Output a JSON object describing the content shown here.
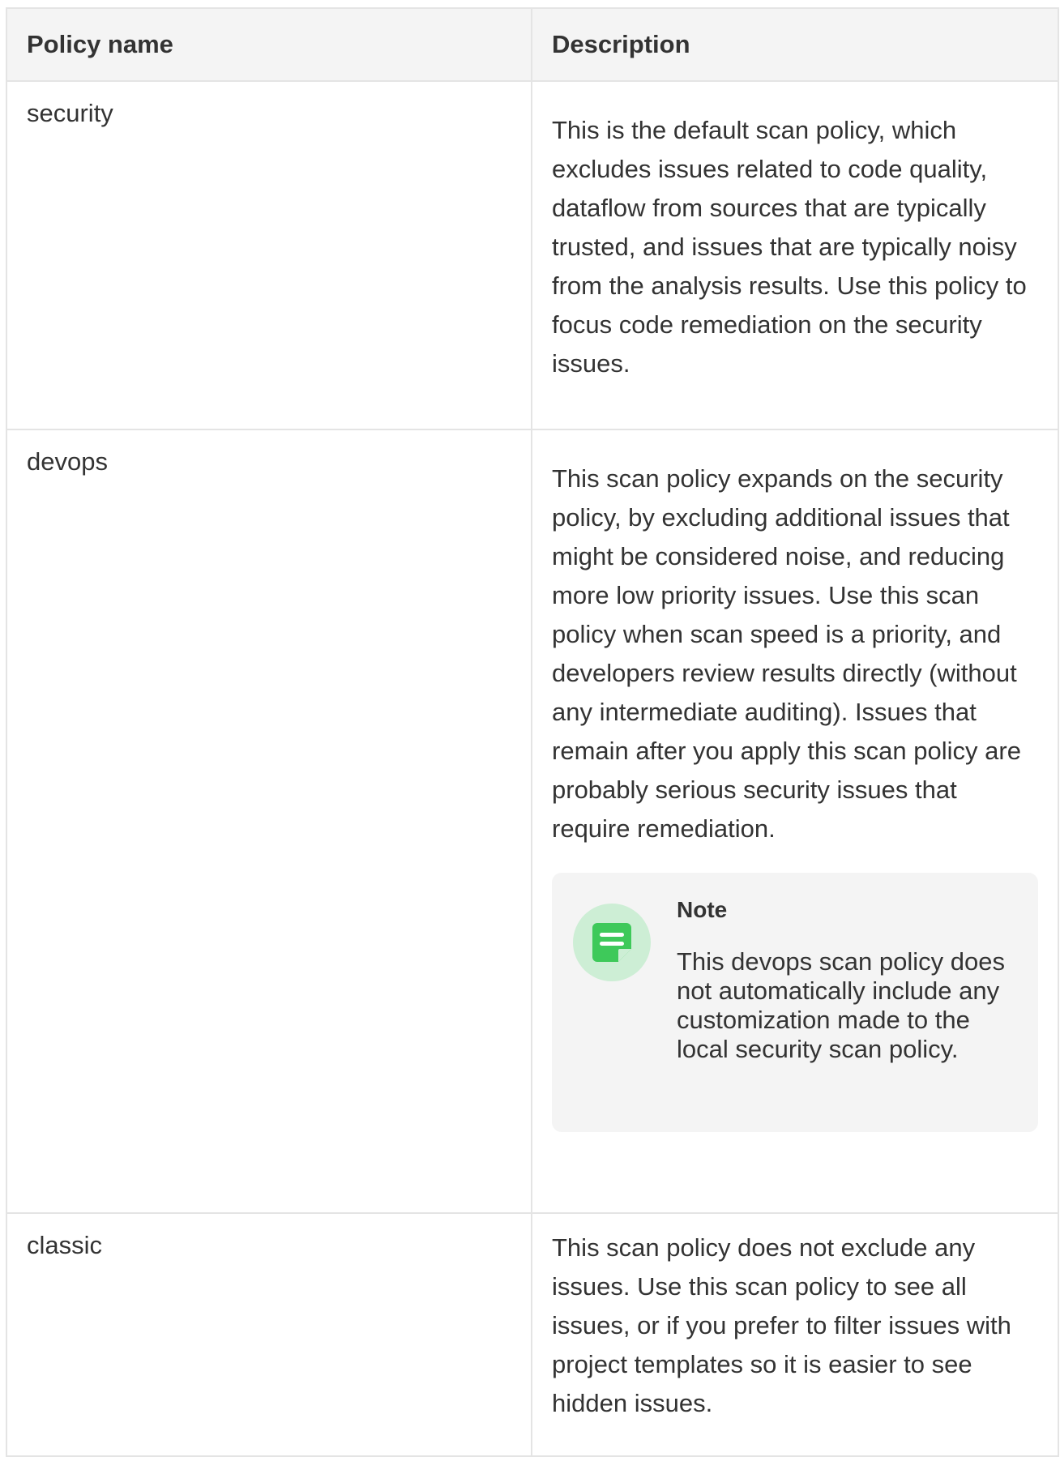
{
  "table": {
    "headers": {
      "policy_name": "Policy name",
      "description": "Description"
    },
    "rows": [
      {
        "name": "security",
        "description": "This is the default scan policy, which excludes issues related to code quality, dataflow from sources that are typically trusted, and issues that are typically noisy from the analysis results. Use this policy to focus code remediation on the security issues."
      },
      {
        "name": "devops",
        "description": "This scan policy expands on the security policy, by excluding additional issues that might be considered noise, and reducing more low priority issues. Use this scan policy when scan speed is a priority, and developers review results directly (without any intermediate auditing). Issues that remain after you apply this scan policy are probably serious security issues that require remediation.",
        "note": {
          "title": "Note",
          "body": "This devops scan policy does not automatically include any customization made to the local security scan policy.",
          "icon": "note-icon"
        }
      },
      {
        "name": "classic",
        "description": "This scan policy does not exclude any issues. Use this scan policy to see all issues, or if you prefer to filter issues with project templates so it is easier to see hidden issues."
      }
    ]
  },
  "colors": {
    "note_icon": "#3ec95a",
    "note_icon_bg": "#cdeed5",
    "header_bg": "#f4f4f4",
    "border": "#e4e4e4",
    "text": "#333333"
  }
}
